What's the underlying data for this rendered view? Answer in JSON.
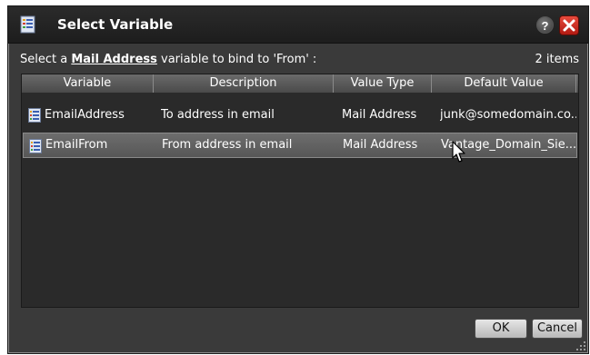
{
  "dialog": {
    "title": "Select Variable",
    "help_label": "?",
    "prompt_prefix": "Select a",
    "prompt_type": "Mail Address",
    "prompt_suffix": "variable to bind to 'From' :",
    "item_count": "2 items"
  },
  "table": {
    "columns": [
      "Variable",
      "Description",
      "Value Type",
      "Default Value"
    ],
    "rows": [
      {
        "variable": "EmailAddress",
        "description": "To address in email",
        "value_type": "Mail Address",
        "default_value": "junk@somedomain.co..."
      },
      {
        "variable": "EmailFrom",
        "description": "From address in email",
        "value_type": "Mail Address",
        "default_value": "Vantage_Domain_Sie..."
      }
    ],
    "selected_row": 1
  },
  "buttons": {
    "ok": "OK",
    "cancel": "Cancel"
  },
  "icons": {
    "title": "variable-list-icon",
    "help": "help-icon",
    "close": "close-icon",
    "row": "variable-icon",
    "resize": "resize-grip-icon",
    "cursor": "mouse-pointer-icon"
  },
  "colors": {
    "dialog_bg": "#3a3a3a",
    "titlebar_bg": "#1d1d1d",
    "grid_bg": "#2a2a2a",
    "selected_row_bg": "#5f5f5f",
    "close_red": "#c8281c"
  }
}
